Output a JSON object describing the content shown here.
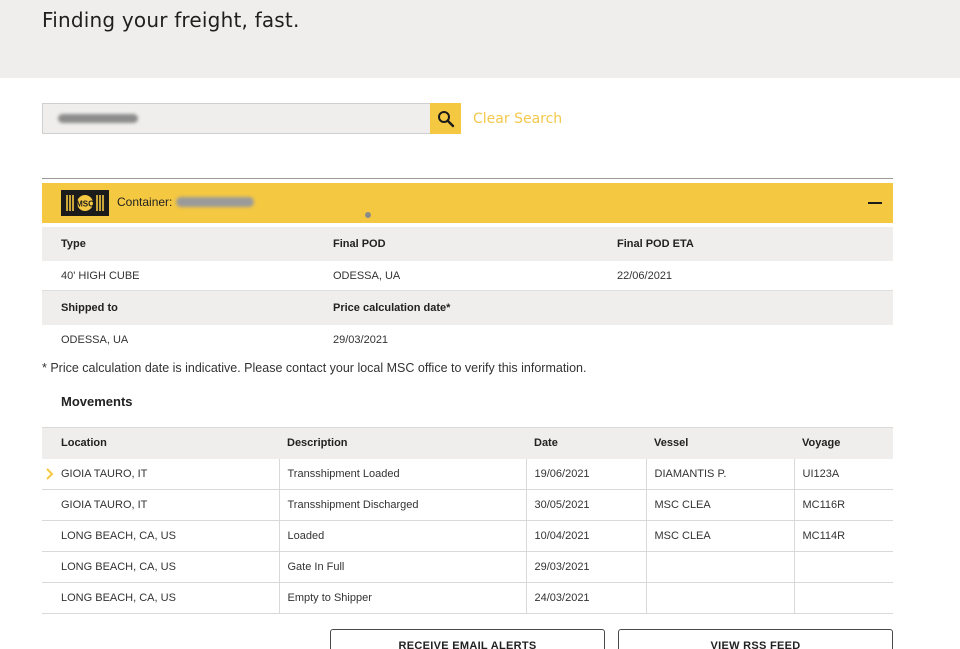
{
  "hero": {
    "title": "Finding your freight, fast."
  },
  "search": {
    "value": "",
    "clear_label": "Clear Search"
  },
  "container": {
    "label": "Container:",
    "logo_text": "MSC"
  },
  "info": {
    "headers_row1": [
      "Type",
      "Final POD",
      "Final POD ETA"
    ],
    "values_row1": [
      "40' HIGH CUBE",
      "ODESSA, UA",
      "22/06/2021"
    ],
    "headers_row2": [
      "Shipped to",
      "Price calculation date*",
      ""
    ],
    "values_row2": [
      "ODESSA, UA",
      "29/03/2021",
      ""
    ]
  },
  "footnote": "* Price calculation date is indicative. Please contact your local MSC office to verify this information.",
  "movements": {
    "title": "Movements",
    "columns": [
      "Location",
      "Description",
      "Date",
      "Vessel",
      "Voyage"
    ],
    "rows": [
      [
        "GIOIA TAURO, IT",
        "Transshipment Loaded",
        "19/06/2021",
        "DIAMANTIS P.",
        "UI123A"
      ],
      [
        "GIOIA TAURO, IT",
        "Transshipment Discharged",
        "30/05/2021",
        "MSC CLEA",
        "MC116R"
      ],
      [
        "LONG BEACH, CA, US",
        "Loaded",
        "10/04/2021",
        "MSC CLEA",
        "MC114R"
      ],
      [
        "LONG BEACH, CA, US",
        "Gate In Full",
        "29/03/2021",
        "",
        ""
      ],
      [
        "LONG BEACH, CA, US",
        "Empty to Shipper",
        "24/03/2021",
        "",
        ""
      ]
    ]
  },
  "buttons": {
    "email": "RECEIVE EMAIL ALERTS",
    "rss": "VIEW RSS FEED"
  },
  "colors": {
    "accent": "#f5c842",
    "panel": "#efeeec",
    "clear_link": "#f3c84a"
  }
}
